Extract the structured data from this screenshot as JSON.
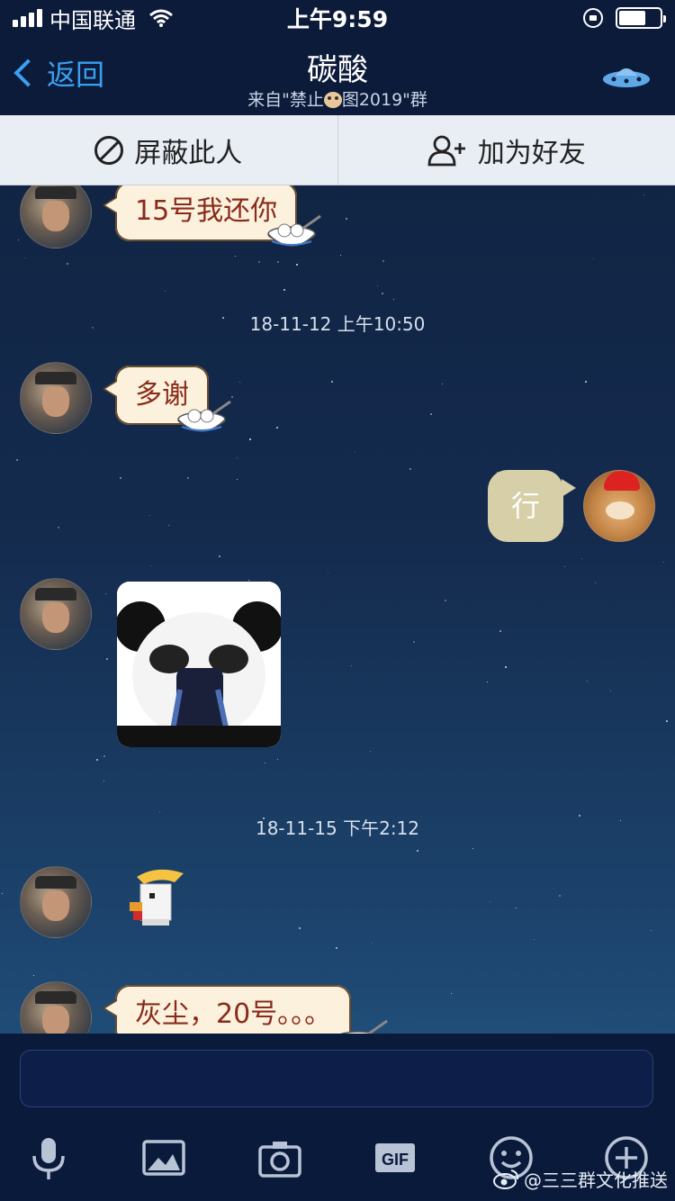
{
  "status_bar": {
    "carrier": "中国联通",
    "time": "上午9:59",
    "battery_level": 0.65
  },
  "nav": {
    "back_label": "返回",
    "title": "碳酸",
    "subtitle_prefix": "来自\"禁止",
    "subtitle_suffix": "图2019\"群"
  },
  "actions": {
    "block_label": "屏蔽此人",
    "add_friend_label": "加为好友"
  },
  "messages": {
    "m1": "15号我还你",
    "ts1": "18-11-12 上午10:50",
    "m2": "多谢",
    "m3": "行",
    "ts2": "18-11-15 下午2:12",
    "m4": "灰尘，20号。。。"
  },
  "input": {
    "placeholder": ""
  },
  "watermark": "@三三群文化推送",
  "colors": {
    "accent": "#3aa0f0",
    "bubble_bg": "#fbf1dc",
    "bubble_text": "#8a2a1b",
    "my_bubble": "#d6cfa7"
  },
  "icons": [
    "back-chevron-icon",
    "ufo-icon",
    "block-icon",
    "add-friend-icon",
    "microphone-icon",
    "image-icon",
    "camera-icon",
    "gif-icon",
    "emoji-icon",
    "plus-icon",
    "weibo-icon"
  ]
}
